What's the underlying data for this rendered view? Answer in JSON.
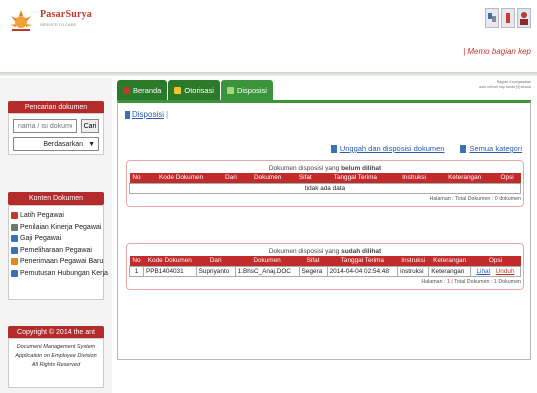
{
  "header": {
    "brand": "PasarSurya",
    "brand_tagline": "SERVICE TO CARE",
    "memo_title": "| Memo bagian kep",
    "description": [
      "Bagian Kepegawaian",
      "auto refresh tiap tanda [ll] sesuai"
    ],
    "colors": {
      "brand": "#c0392b",
      "accent": "#3b943b"
    },
    "icons": [
      "language-icon",
      "user-avatar-icon"
    ]
  },
  "sidebar": {
    "search_title": "Pencarian dokumen",
    "search_placeholder": "nama / isi dokumen",
    "search_button": "Cari",
    "search_filter": "Berdasarkan",
    "konten_title": "Konten Dokumen",
    "konten_items": [
      {
        "label": "Latih Pegawai",
        "color": "#c0392b",
        "icon": "training-icon"
      },
      {
        "label": "Penilaian Kinerja Pegawai",
        "color": "#6a7a6a",
        "icon": "assessment-icon"
      },
      {
        "label": "Gaji Pegawai",
        "color": "#3a70b8",
        "icon": "salary-icon"
      },
      {
        "label": "Pemeliharaan Pegawai",
        "color": "#3a70b8",
        "icon": "maintenance-icon"
      },
      {
        "label": "Penerimaan Pegawai Baru",
        "color": "#e08a1e",
        "icon": "recruitment-icon"
      },
      {
        "label": "Pemutusan Hubungan Kerja",
        "color": "#3a70b8",
        "icon": "termination-icon"
      }
    ],
    "copyright_title": "Copyright © 2014 the ant",
    "copyright_lines": [
      "Document Management System",
      "Application on Employee Division",
      "All Rights Reserved"
    ]
  },
  "main": {
    "tabs": [
      {
        "label": "Beranda",
        "icon": "home-icon",
        "color": "#c0392b"
      },
      {
        "label": "Otorisasi",
        "icon": "authorization-icon",
        "color": "#f2c12e"
      },
      {
        "label": "Disposisi",
        "icon": "disposition-icon",
        "color": "#a7d97b"
      }
    ],
    "breadcrumb": "Disposisi",
    "actions": [
      {
        "label": "Unggah dan disposisi dokumen",
        "icon": "upload-icon"
      },
      {
        "label": "Semua kategori",
        "icon": "category-icon"
      }
    ],
    "table_unread": {
      "title_prefix": "Dokumen disposisi yang ",
      "title_bold": "belum dilihat",
      "columns": [
        "No",
        "Kode Dokumen",
        "Dari",
        "Dokumen",
        "Sifat",
        "Tanggal Terima",
        "Instruksi",
        "Keterangan",
        "Opsi"
      ],
      "empty_text": "tidak ada data",
      "pagination_prefix": "Halaman : Total Dokumen : ",
      "pagination_count": "0",
      "pagination_suffix": " dokumen"
    },
    "table_read": {
      "title_prefix": "Dokumen disposisi yang ",
      "title_bold": "sudah dilihat",
      "columns": [
        "No",
        "Kode Dokumen",
        "Dari",
        "Dokumen",
        "Sifat",
        "Tanggal Terima",
        "Instruksi",
        "Keterangan",
        "Opsi"
      ],
      "rows": [
        {
          "no": "1",
          "kode": "PPB1404031",
          "dari": "Supriyanto",
          "dokumen": "1.BhsC_Anaj.DOC",
          "sifat": "Segera",
          "tanggal": "2014-04-04 02:54:48",
          "instruksi": "instruksi",
          "keterangan": "Keterangan",
          "opsi_lihat": "Lihat",
          "opsi_unduh": "Unduh"
        }
      ],
      "pagination_prefix": "Halaman : ",
      "pagination_page": "1",
      "pagination_mid": " | Total Dokumen : ",
      "pagination_count": "1",
      "pagination_suffix": " Dokumen"
    }
  }
}
